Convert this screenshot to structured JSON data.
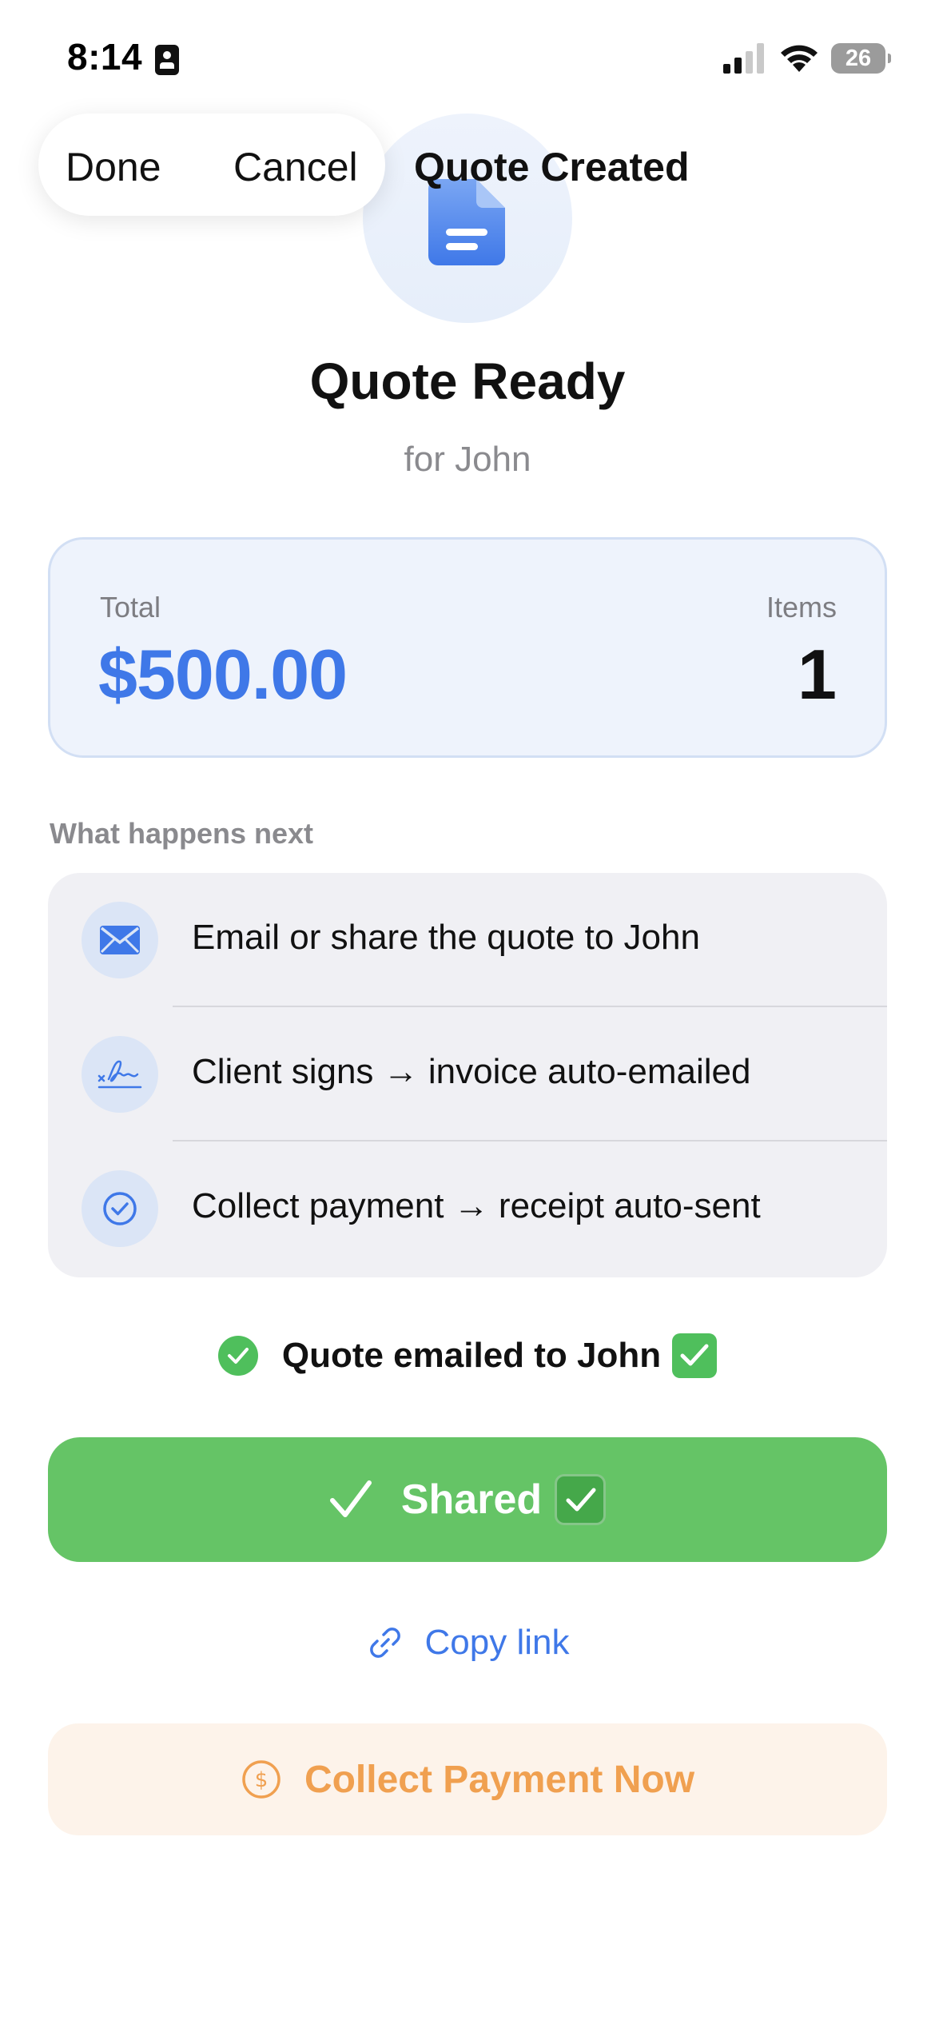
{
  "status_bar": {
    "time": "8:14",
    "battery": "26"
  },
  "nav": {
    "done_label": "Done",
    "cancel_label": "Cancel",
    "title": "Quote Created"
  },
  "hero": {
    "icon": "document-icon",
    "heading": "Quote Ready",
    "subheading": "for John"
  },
  "summary": {
    "total_label": "Total",
    "total_value": "$500.00",
    "items_label": "Items",
    "items_value": "1"
  },
  "next_steps": {
    "section_label": "What happens next",
    "steps": [
      {
        "icon": "envelope-icon",
        "text": "Email or share the quote to John"
      },
      {
        "icon": "signature-icon",
        "text": "Client signs → invoice auto-emailed"
      },
      {
        "icon": "check-circle-icon",
        "text": "Collect payment → receipt auto-sent"
      }
    ]
  },
  "status": {
    "message": "Quote emailed to John"
  },
  "actions": {
    "shared_label": "Shared",
    "copy_link_label": "Copy link",
    "collect_payment_label": "Collect Payment Now"
  },
  "colors": {
    "accent_blue": "#3f78e8",
    "success_green": "#65c466",
    "collect_orange": "#f0a050",
    "card_blue_bg": "#eef3fc",
    "steps_bg": "#f0f0f4"
  }
}
